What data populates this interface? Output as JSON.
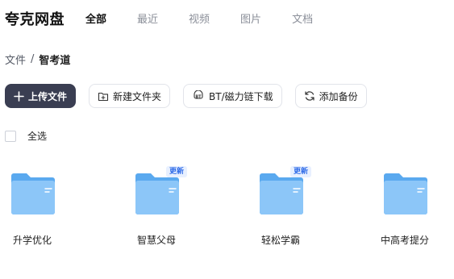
{
  "app": {
    "logo": "夸克网盘"
  },
  "nav": [
    {
      "label": "全部",
      "active": true
    },
    {
      "label": "最近"
    },
    {
      "label": "视频"
    },
    {
      "label": "图片"
    },
    {
      "label": "文档"
    }
  ],
  "breadcrumb": {
    "root": "文件",
    "separator": "/",
    "current": "智考道"
  },
  "toolbar": {
    "upload": "上传文件",
    "new_folder": "新建文件夹",
    "bt_download": "BT/磁力链下载",
    "add_backup": "添加备份"
  },
  "select_all": "全选",
  "colors": {
    "primary": "#3a3e52",
    "folder": "#7dbbf5",
    "badge_text": "#2f6be8"
  },
  "files": [
    {
      "name": "升学优化",
      "badge": ""
    },
    {
      "name": "智慧父母",
      "badge": "更新"
    },
    {
      "name": "轻松学霸",
      "badge": "更新"
    },
    {
      "name": "中高考提分",
      "badge": ""
    }
  ]
}
